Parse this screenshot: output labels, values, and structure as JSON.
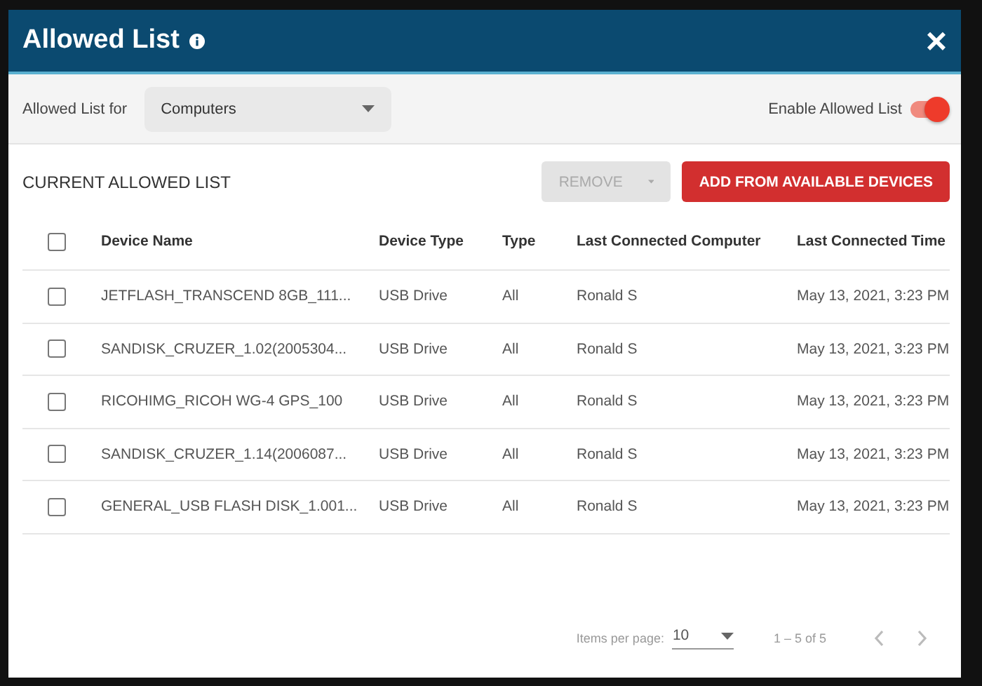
{
  "dialog": {
    "title": "Allowed List",
    "close": "×"
  },
  "filter": {
    "label": "Allowed List for",
    "value": "Computers",
    "toggle_label": "Enable Allowed List",
    "toggle_on": true
  },
  "section_title": "CURRENT ALLOWED LIST",
  "buttons": [
    {
      "label": "REMOVE",
      "kind": "menu",
      "disabled": true
    },
    {
      "label": "ADD FROM AVAILABLE DEVICES",
      "kind": "primary",
      "disabled": false
    }
  ],
  "table": {
    "select_all_checked": false,
    "columns": [
      "Device Name",
      "Device Type",
      "Type",
      "Last Connected Computer",
      "Last Connected Time"
    ],
    "rows": [
      {
        "checked": false,
        "cells": [
          "JETFLASH_TRANSCEND 8GB_111...",
          "USB Drive",
          "All",
          "Ronald S",
          "May 13, 2021, 3:23 PM"
        ]
      },
      {
        "checked": false,
        "cells": [
          "SANDISK_CRUZER_1.02(2005304...",
          "USB Drive",
          "All",
          "Ronald S",
          "May 13, 2021, 3:23 PM"
        ]
      },
      {
        "checked": false,
        "cells": [
          "RICOHIMG_RICOH WG-4 GPS_100",
          "USB Drive",
          "All",
          "Ronald S",
          "May 13, 2021, 3:23 PM"
        ]
      },
      {
        "checked": false,
        "cells": [
          "SANDISK_CRUZER_1.14(2006087...",
          "USB Drive",
          "All",
          "Ronald S",
          "May 13, 2021, 3:23 PM"
        ]
      },
      {
        "checked": false,
        "cells": [
          "GENERAL_USB FLASH DISK_1.001...",
          "USB Drive",
          "All",
          "Ronald S",
          "May 13, 2021, 3:23 PM"
        ]
      }
    ]
  },
  "paginator": {
    "items_label": "Items per page:",
    "page_size": "10",
    "range": "1 – 5 of 5",
    "prev_disabled": true,
    "next_disabled": true
  }
}
